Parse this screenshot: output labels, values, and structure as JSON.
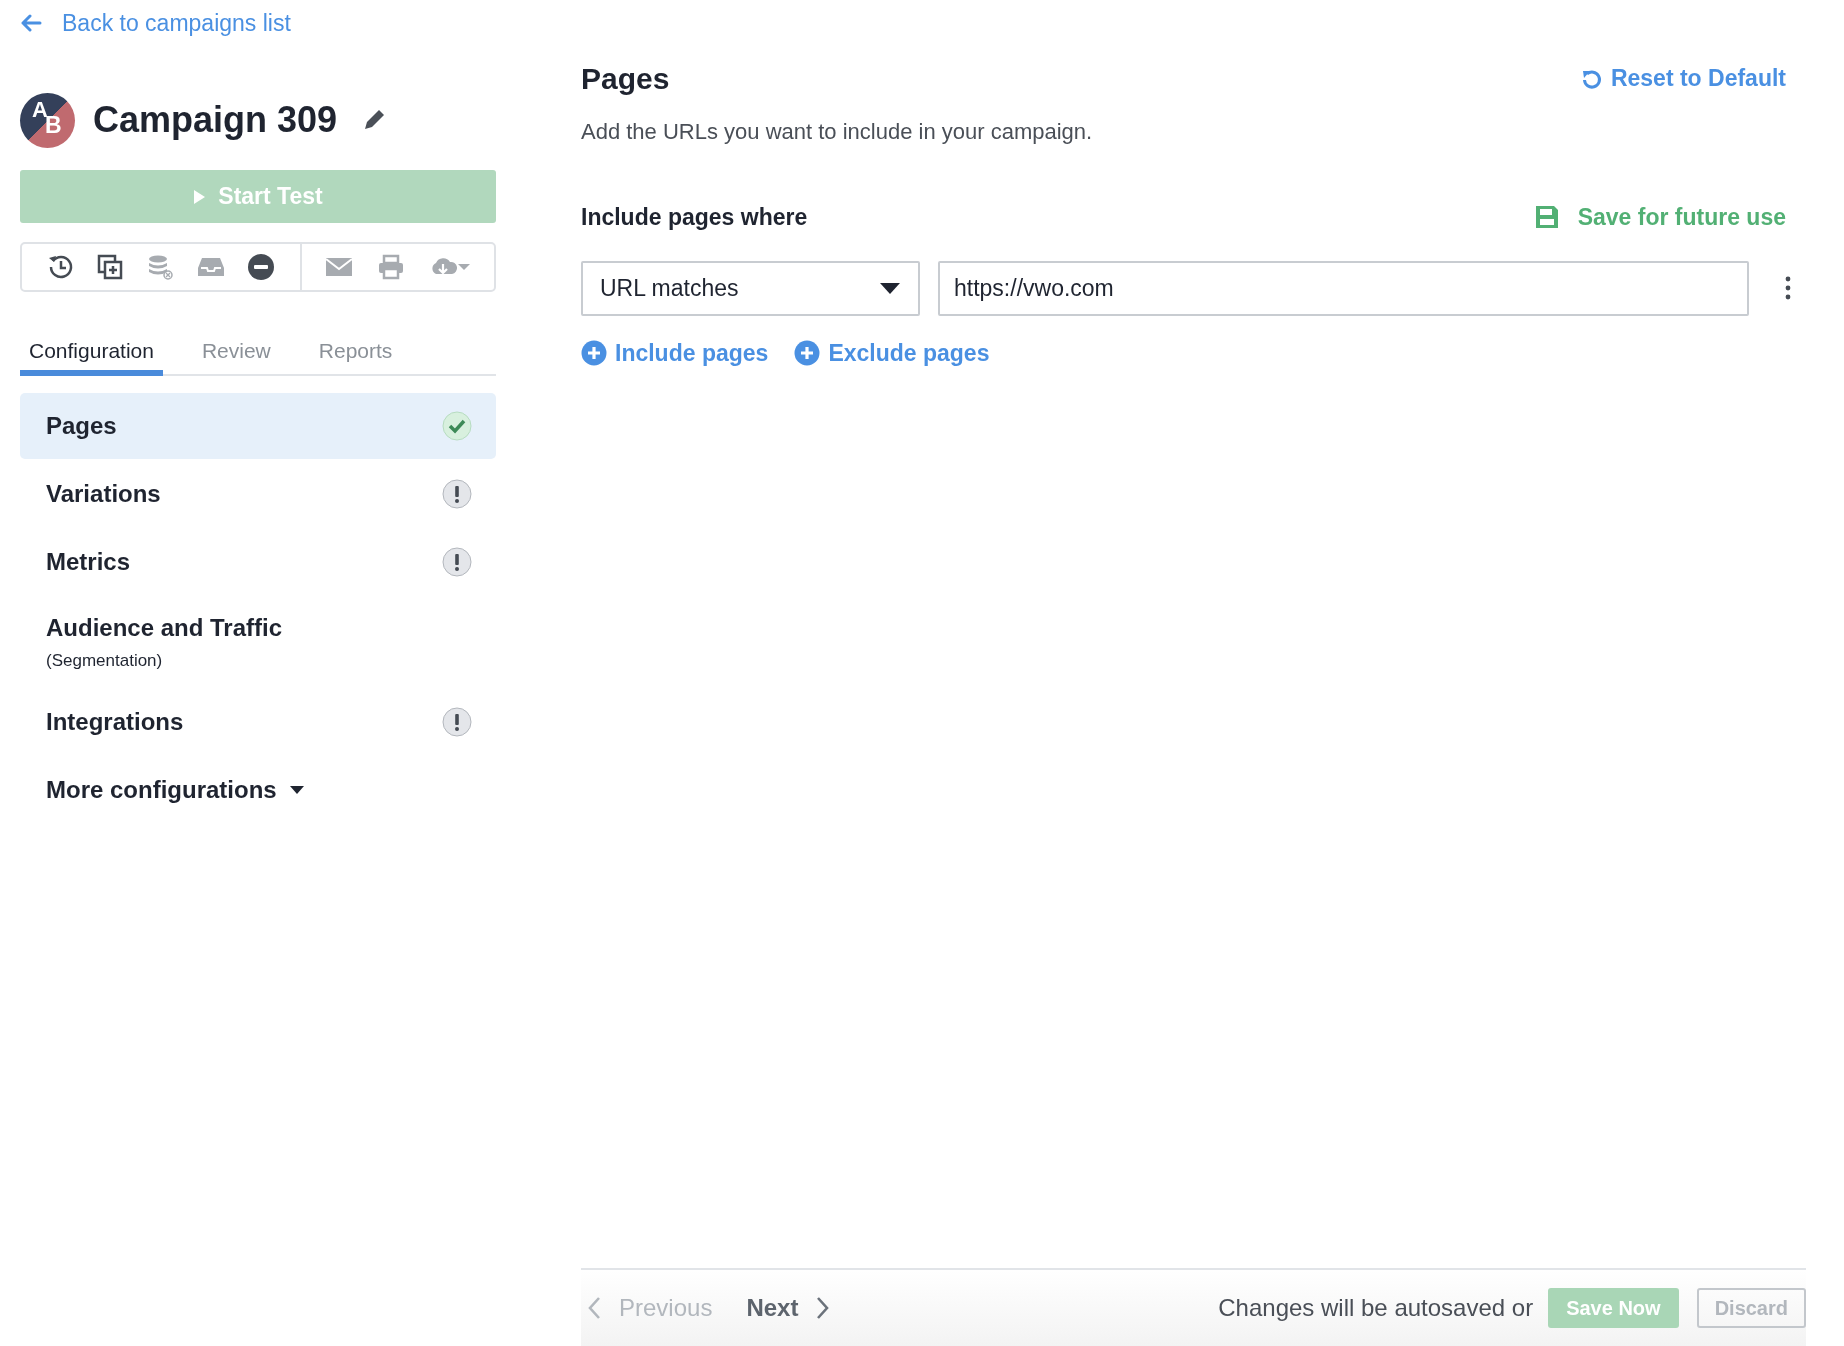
{
  "back_link": "Back to campaigns list",
  "campaign": {
    "avatar_letters": [
      "A",
      "B"
    ],
    "title": "Campaign 309"
  },
  "start_button": {
    "label": "Start Test",
    "disabled": true
  },
  "toolbar": [
    {
      "kind": "history",
      "disabled": false
    },
    {
      "kind": "clone",
      "disabled": false
    },
    {
      "kind": "database",
      "disabled": true
    },
    {
      "kind": "archive",
      "disabled": true
    },
    {
      "kind": "stop",
      "disabled": false
    },
    {
      "kind": "mail",
      "disabled": true
    },
    {
      "kind": "print",
      "disabled": true
    },
    {
      "kind": "download",
      "disabled": true
    }
  ],
  "tabs": [
    {
      "label": "Configuration",
      "selected": true
    },
    {
      "label": "Review",
      "selected": false
    },
    {
      "label": "Reports",
      "selected": false
    }
  ],
  "sidebar": {
    "items": [
      {
        "label": "Pages",
        "selected": true,
        "kind": "done"
      },
      {
        "label": "Variations",
        "selected": false,
        "kind": "warning"
      },
      {
        "label": "Metrics",
        "selected": false,
        "kind": "warning"
      },
      {
        "label": "Audience and Traffic",
        "sublabel": "(Segmentation)",
        "selected": false,
        "kind": "plain"
      },
      {
        "label": "Integrations",
        "selected": false,
        "kind": "warning"
      }
    ],
    "more": "More configurations"
  },
  "main": {
    "title": "Pages",
    "reset": "Reset to Default",
    "description": "Add the URLs you want to include in your campaign.",
    "section_title": "Include pages where",
    "save_future": "Save for future use",
    "rule": {
      "condition": "URL matches",
      "value": "https://vwo.com"
    },
    "links": [
      "Include pages",
      "Exclude pages"
    ]
  },
  "footer": {
    "previous": {
      "label": "Previous",
      "disabled": true
    },
    "next": {
      "label": "Next",
      "disabled": false
    },
    "note": "Changes will be autosaved or",
    "save": {
      "label": "Save Now",
      "disabled": true
    },
    "discard": {
      "label": "Discard",
      "disabled": true
    }
  }
}
